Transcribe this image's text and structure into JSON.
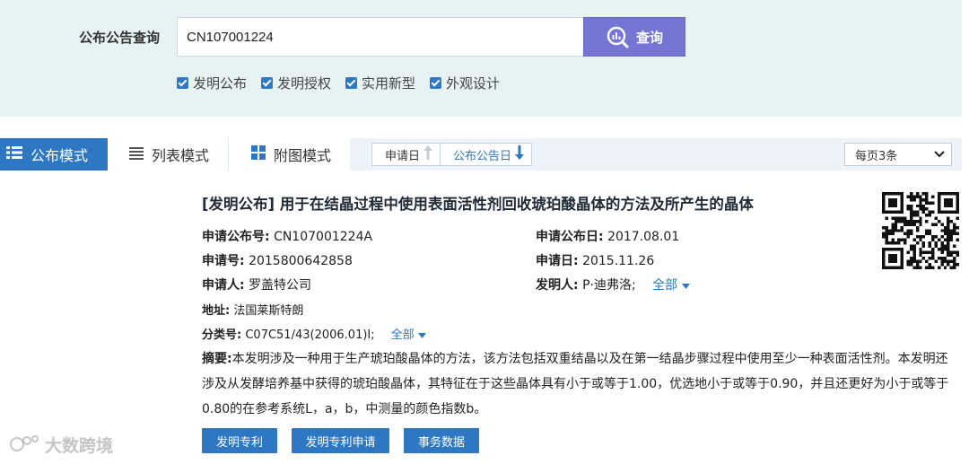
{
  "search": {
    "label": "公布公告查询",
    "value": "CN107001224",
    "button_label": "查询",
    "filters": [
      {
        "label": "发明公布",
        "checked": true
      },
      {
        "label": "发明授权",
        "checked": true
      },
      {
        "label": "实用新型",
        "checked": true
      },
      {
        "label": "外观设计",
        "checked": true
      }
    ]
  },
  "modes": {
    "tabs": [
      {
        "label": "公布模式",
        "icon": "list-bullet-icon",
        "active": true
      },
      {
        "label": "列表模式",
        "icon": "list-lines-icon",
        "active": false
      },
      {
        "label": "附图模式",
        "icon": "grid-icon",
        "active": false
      }
    ],
    "sort": [
      {
        "label": "申请日",
        "icon": "arrow-up-icon"
      },
      {
        "label": "公布公告日",
        "icon": "arrow-down-icon"
      }
    ],
    "per_page": "每页3条"
  },
  "result": {
    "title": "[发明公布] 用于在结晶过程中使用表面活性剂回收琥珀酸晶体的方法及所产生的晶体",
    "pub_no_label": "申请公布号:",
    "pub_no": "CN107001224A",
    "pub_date_label": "申请公布日:",
    "pub_date": "2017.08.01",
    "app_no_label": "申请号:",
    "app_no": "2015800642858",
    "app_date_label": "申请日:",
    "app_date": "2015.11.26",
    "applicant_label": "申请人:",
    "applicant": "罗盖特公司",
    "inventor_label": "发明人:",
    "inventor": "P·迪弗洛;",
    "inventor_more": "全部",
    "address_label": "地址:",
    "address": "法国莱斯特朗",
    "class_label": "分类号:",
    "class": "C07C51/43(2006.01)I;",
    "class_more": "全部",
    "abstract_label": "摘要:",
    "abstract": "本发明涉及一种用于生产琥珀酸晶体的方法，该方法包括双重结晶以及在第一结晶步骤过程中使用至少一种表面活性剂。本发明还涉及从发酵培养基中获得的琥珀酸晶体，其特征在于这些晶体具有小于或等于1.00，优选地小于或等于0.90，并且还更好为小于或等于0.80的在参考系统L，a，b，中测量的颜色指数b。",
    "actions": [
      "发明专利",
      "发明专利申请",
      "事务数据"
    ]
  },
  "watermark": "大数跨境",
  "colors": {
    "accent": "#2e77c2",
    "search_button": "#7575d4",
    "header_bg": "#e7f3f3"
  }
}
